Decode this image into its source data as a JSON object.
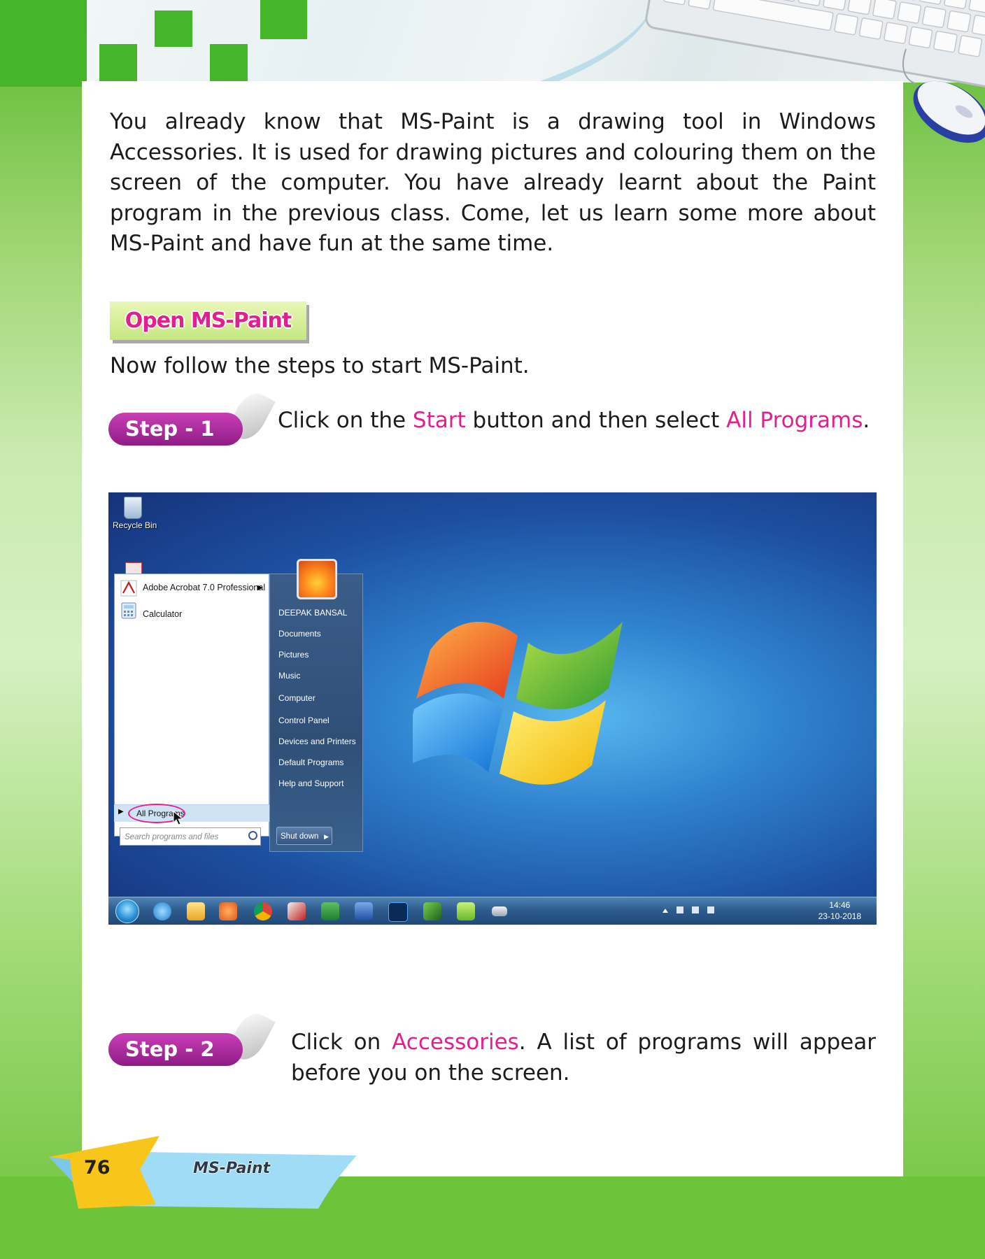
{
  "intro": "You already know that MS-Paint is a drawing tool in Windows Accessories. It is used for drawing pictures and colouring them on the screen of the computer. You have already learnt about the Paint program in the previous class. Come, let us learn some more about MS-Paint and have fun at the same time.",
  "section_heading": "Open MS-Paint",
  "steps_intro": "Now follow the steps to start MS-Paint.",
  "step1": {
    "badge": "Step - 1",
    "pre": "Click on the ",
    "hl1": "Start",
    "mid": " button and then select ",
    "hl2": "All Programs",
    "post": "."
  },
  "step2": {
    "badge": "Step - 2",
    "pre": "Click on ",
    "hl1": "Accessories",
    "post": ". A list of programs will appear before you on the screen."
  },
  "screenshot": {
    "desktop_icon_label": "Recycle Bin",
    "pinned_programs": [
      "Adobe Acrobat 7.0 Professional",
      "Calculator"
    ],
    "right_items": [
      "DEEPAK BANSAL",
      "Documents",
      "Pictures",
      "Music",
      "Computer",
      "Control Panel",
      "Devices and Printers",
      "Default Programs",
      "Help and Support"
    ],
    "all_programs": "All Programs",
    "search_placeholder": "Search programs and files",
    "shutdown": "Shut down",
    "time": "14:46",
    "date": "23-10-2018"
  },
  "footer": {
    "page_number": "76",
    "chapter": "MS-Paint"
  },
  "colors": {
    "highlight": "#e0208c",
    "green": "#45b52a",
    "step_badge": "#a5279c"
  }
}
